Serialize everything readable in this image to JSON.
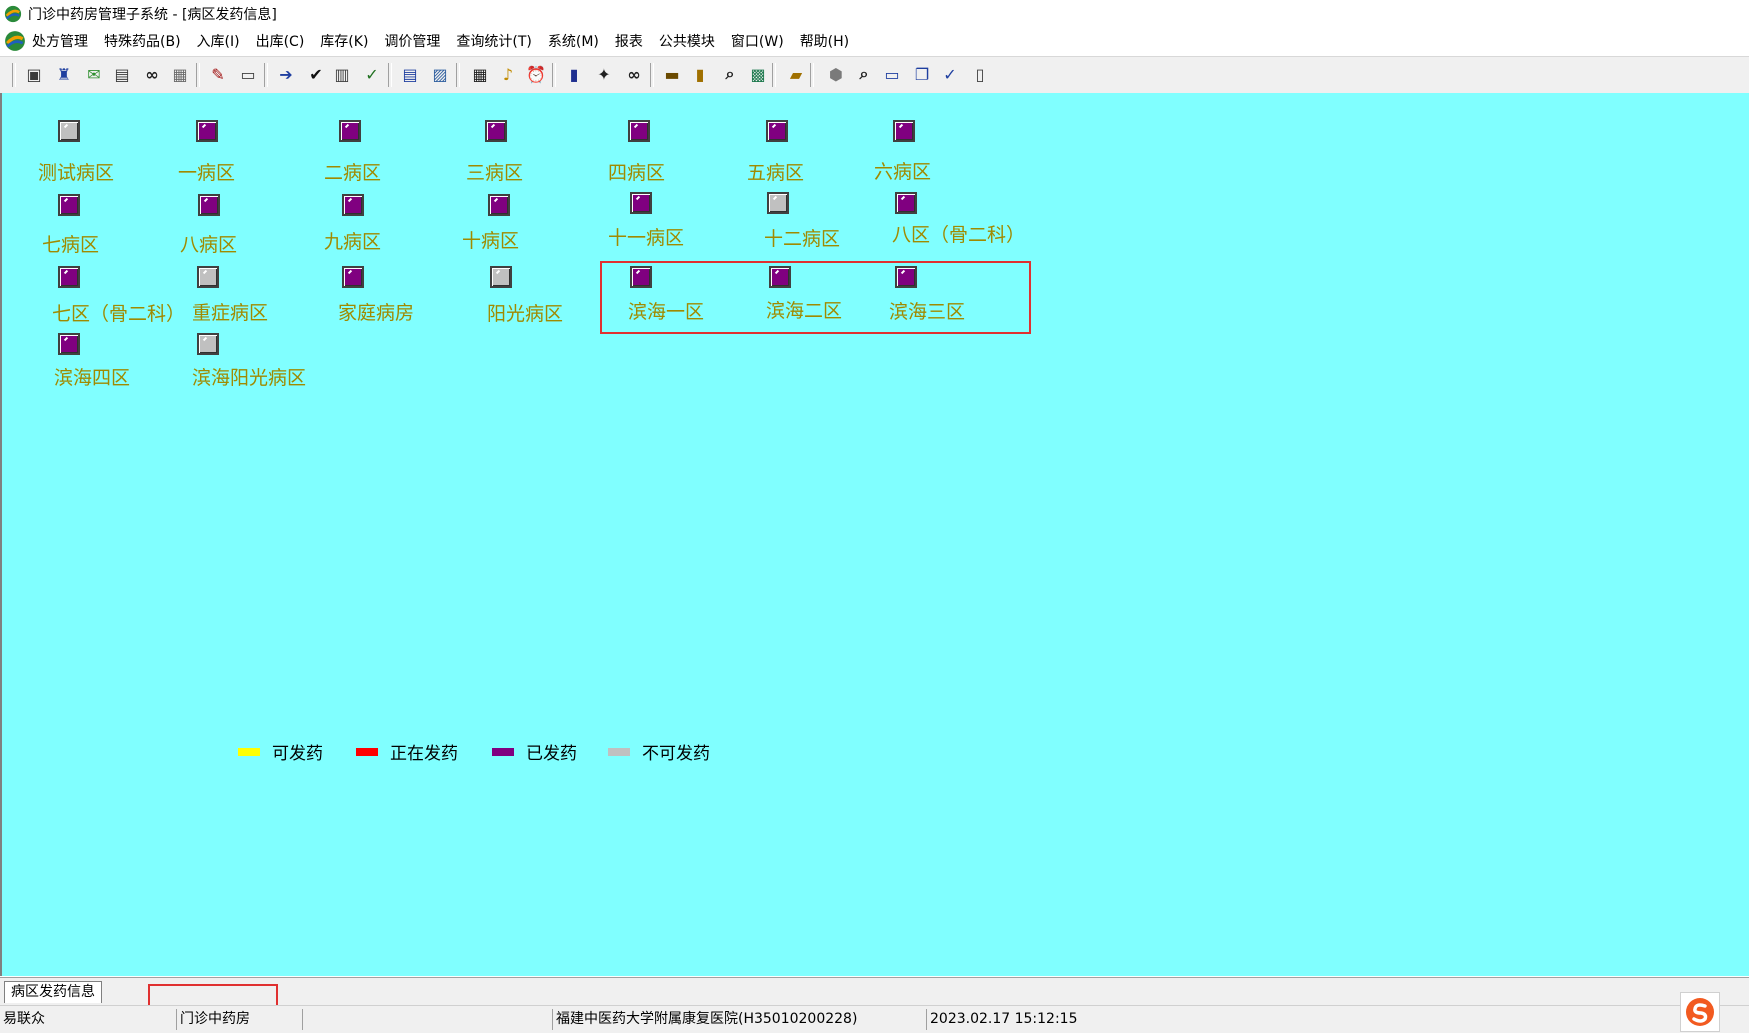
{
  "window": {
    "title": "门诊中药房管理子系统 - [病区发药信息]"
  },
  "menu": {
    "items": [
      {
        "label": "处方管理"
      },
      {
        "label": "特殊药品(B)"
      },
      {
        "label": "入库(I)"
      },
      {
        "label": "出库(C)"
      },
      {
        "label": "库存(K)"
      },
      {
        "label": "调价管理"
      },
      {
        "label": "查询统计(T)"
      },
      {
        "label": "系统(M)"
      },
      {
        "label": "报表"
      },
      {
        "label": "公共模块"
      },
      {
        "label": "窗口(W)"
      },
      {
        "label": "帮助(H)"
      }
    ]
  },
  "toolbar": {
    "buttons": [
      {
        "icon": "print-preview-icon",
        "color": "#3a3a3a"
      },
      {
        "icon": "bottle-icon",
        "color": "#1f3f9f"
      },
      {
        "icon": "check-mail-icon",
        "color": "#2f8f2f"
      },
      {
        "icon": "document-list-icon",
        "color": "#3a3a3a"
      },
      {
        "icon": "binoculars-icon",
        "color": "#202020"
      },
      {
        "icon": "grid-report-icon",
        "color": "#6a6a6a"
      },
      {
        "icon": "tag-icon",
        "color": "#a01010"
      },
      {
        "icon": "card-icon",
        "color": "#404040"
      },
      {
        "icon": "document-arrow-icon",
        "color": "#1f3fa0"
      },
      {
        "icon": "checkmark-icon",
        "color": "#101010"
      },
      {
        "icon": "paste-icon",
        "color": "#404040"
      },
      {
        "icon": "check-document-icon",
        "color": "#207020"
      },
      {
        "icon": "edit-table-icon",
        "color": "#1f3fa0"
      },
      {
        "icon": "image-icon",
        "color": "#2f5f9f"
      },
      {
        "icon": "keypad-icon",
        "color": "#202020"
      },
      {
        "icon": "bell-icon",
        "color": "#c08a00"
      },
      {
        "icon": "alarm-icon",
        "color": "#a07000"
      },
      {
        "icon": "gift-icon",
        "color": "#1f2f8f"
      },
      {
        "icon": "wand-icon",
        "color": "#202020"
      },
      {
        "icon": "binoculars-search-icon",
        "color": "#202020"
      },
      {
        "icon": "printer-icon",
        "color": "#6a4a00"
      },
      {
        "icon": "thermometer-icon",
        "color": "#a07000"
      },
      {
        "icon": "magnifier-icon",
        "color": "#202020"
      },
      {
        "icon": "excel-icon",
        "color": "#1f7a4f"
      },
      {
        "icon": "open-folder-icon",
        "color": "#a07000"
      },
      {
        "icon": "cube-icon",
        "color": "#7a7a7a"
      },
      {
        "icon": "zoom-icon",
        "color": "#202020"
      },
      {
        "icon": "horizontal-split-icon",
        "color": "#1f3fa0"
      },
      {
        "icon": "cascade-icon",
        "color": "#1f3fa0"
      },
      {
        "icon": "check-list-icon",
        "color": "#1f3fa0"
      },
      {
        "icon": "clipboard-icon",
        "color": "#404040"
      }
    ]
  },
  "wards": [
    {
      "label": "测试病区",
      "status": "gray"
    },
    {
      "label": "一病区",
      "status": "purple"
    },
    {
      "label": "二病区",
      "status": "purple"
    },
    {
      "label": "三病区",
      "status": "purple"
    },
    {
      "label": "四病区",
      "status": "purple"
    },
    {
      "label": "五病区",
      "status": "purple"
    },
    {
      "label": "六病区",
      "status": "purple"
    },
    {
      "label": "七病区",
      "status": "purple"
    },
    {
      "label": "八病区",
      "status": "purple"
    },
    {
      "label": "九病区",
      "status": "purple"
    },
    {
      "label": "十病区",
      "status": "purple"
    },
    {
      "label": "十一病区",
      "status": "purple"
    },
    {
      "label": "十二病区",
      "status": "gray"
    },
    {
      "label": "八区（骨二科）",
      "status": "purple"
    },
    {
      "label": "七区（骨二科）",
      "status": "purple"
    },
    {
      "label": "重症病区",
      "status": "gray"
    },
    {
      "label": "家庭病房",
      "status": "purple"
    },
    {
      "label": "阳光病区",
      "status": "gray"
    },
    {
      "label": "滨海一区",
      "status": "purple"
    },
    {
      "label": "滨海二区",
      "status": "purple"
    },
    {
      "label": "滨海三区",
      "status": "purple"
    },
    {
      "label": "滨海四区",
      "status": "purple"
    },
    {
      "label": "滨海阳光病区",
      "status": "gray"
    }
  ],
  "legend": [
    {
      "label": "可发药",
      "color": "#ffff00"
    },
    {
      "label": "正在发药",
      "color": "#ff0000"
    },
    {
      "label": "已发药",
      "color": "#800080"
    },
    {
      "label": "不可发药",
      "color": "#c0c0c0"
    }
  ],
  "colors": {
    "main_bg": "#80ffff",
    "ward_label": "#a08a00",
    "highlight_box": "#e03030"
  },
  "tabs": [
    {
      "label": "病区发药信息"
    }
  ],
  "status": {
    "user": "易联众",
    "pharmacy": "门诊中药房",
    "blank": "",
    "hospital": "福建中医药大学附属康复医院(H35010200228)",
    "datetime": "2023.02.17 15:12:15"
  }
}
